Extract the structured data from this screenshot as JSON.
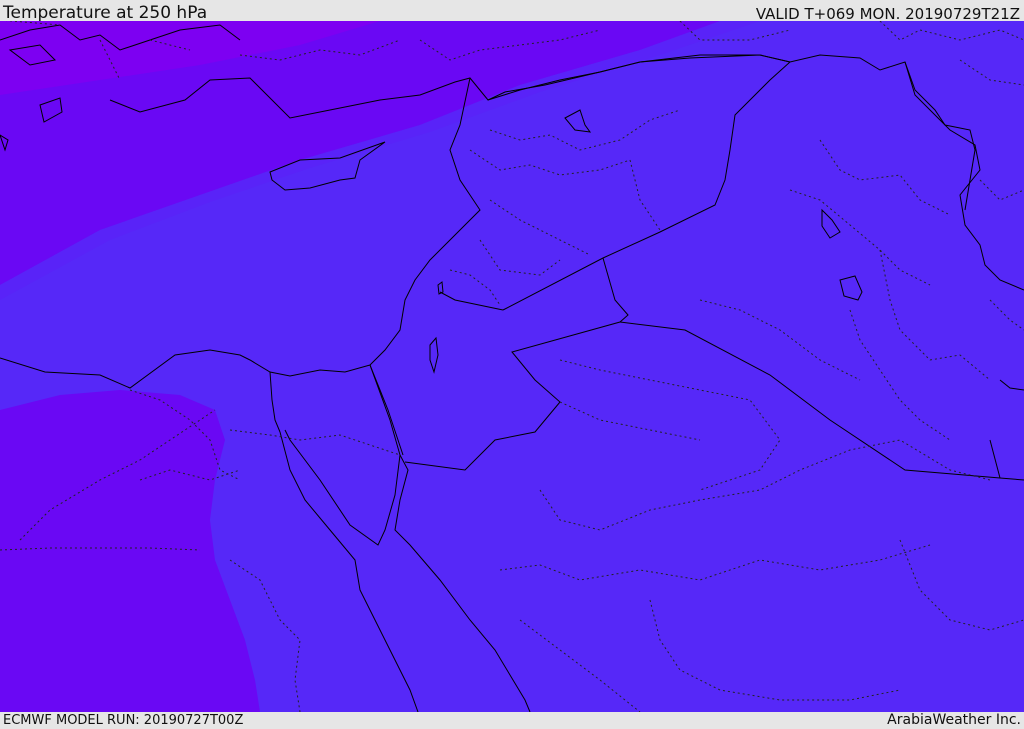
{
  "header": {
    "title": "Temperature at 250 hPa",
    "valid": "VALID T+069 MON. 20190729T21Z"
  },
  "footer": {
    "model_run": "ECMWF MODEL RUN: 20190727T00Z",
    "credit": "ArabiaWeather Inc."
  },
  "map": {
    "field": "temperature",
    "colors": {
      "warmest": "#8000f0",
      "warm": "#6a08f4",
      "mid": "#6818f8",
      "base": "#5628f8",
      "coastline": "#000000",
      "border": "#1a1a40"
    }
  }
}
